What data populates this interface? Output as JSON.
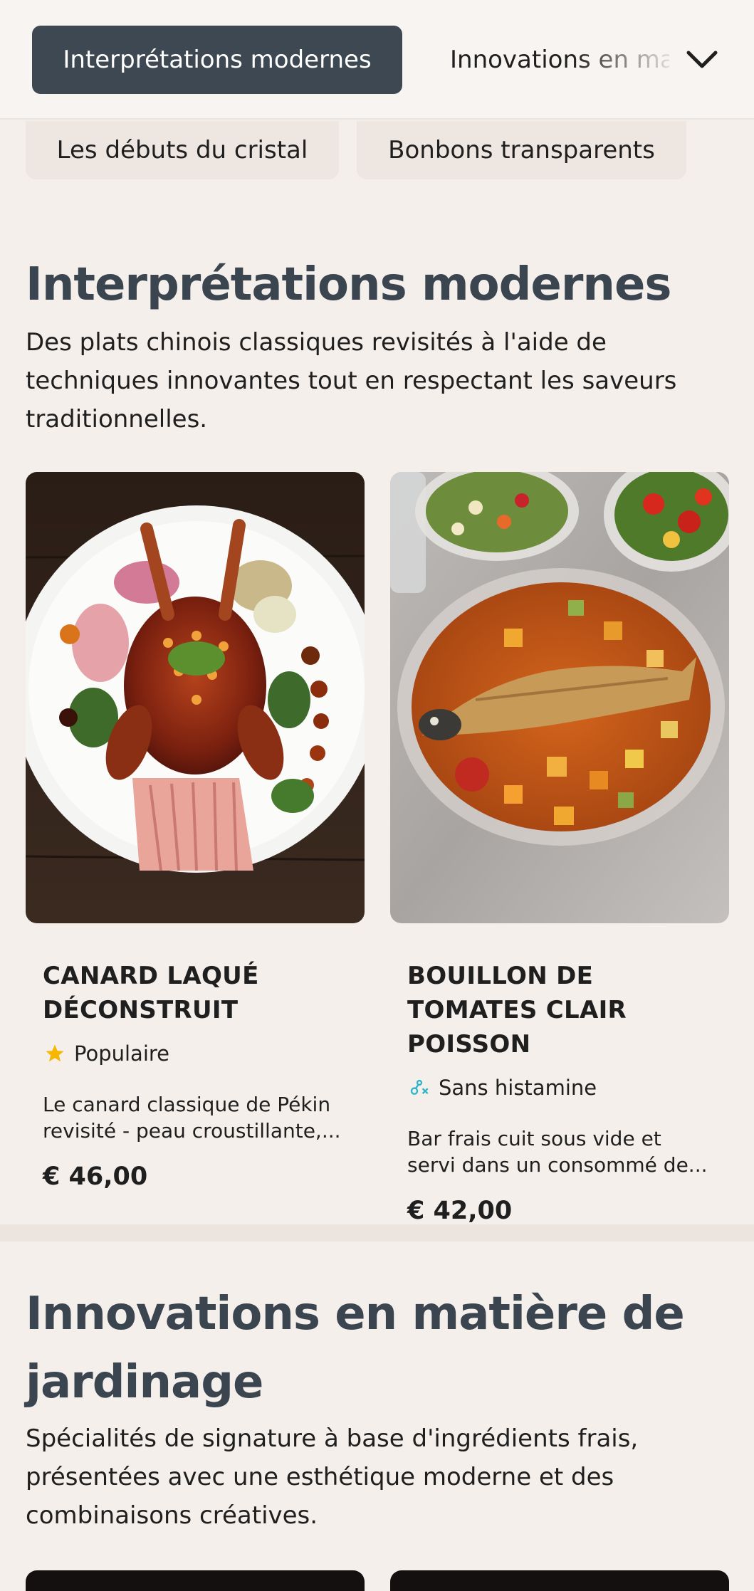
{
  "nav": {
    "active_tab": "Interprétations modernes",
    "next_tab": "Innovations en matière de jardinage",
    "expand_icon": "chevron-down-icon"
  },
  "subnav": {
    "chips": [
      "Les débuts du cristal",
      "Bonbons transparents"
    ]
  },
  "sections": [
    {
      "title": "Interprétations modernes",
      "description": "Des plats chinois classiques revisités à l'aide de techniques innovantes tout en respectant les saveurs traditionnelles.",
      "items": [
        {
          "name": "Canard laqué déconstruit",
          "badge": "Populaire",
          "badge_icon": "star-icon",
          "description": "Le canard classique de Pékin revisité - peau croustillante,...",
          "price": "€ 46,00"
        },
        {
          "name": "Bouillon de tomates clair poisson",
          "badge": "Sans histamine",
          "badge_icon": "molecule-icon",
          "description": "Bar frais cuit sous vide et servi dans un consommé de...",
          "price": "€ 42,00"
        }
      ]
    },
    {
      "title": "Innovations en matière de jardinage",
      "description": "Spécialités de signature à base d'ingrédients frais, présentées avec une esthétique moderne et des combinaisons créatives."
    }
  ],
  "colors": {
    "background": "#f5efeb",
    "active_pill": "#3d4852",
    "heading": "#3a4550",
    "star": "#f5b700",
    "molecule": "#2bb5c8"
  }
}
